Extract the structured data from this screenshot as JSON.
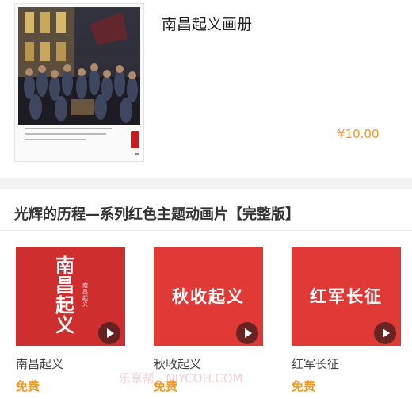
{
  "product": {
    "title": "南昌起义画册",
    "price": "¥10.00",
    "cover_icon": "painting-image"
  },
  "section": {
    "title": "光辉的历程—系列红色主题动画片【完整版】"
  },
  "videos": [
    {
      "thumb_lines": [
        "南",
        "昌",
        "起",
        "义"
      ],
      "thumb_subtitle": "南昌起义",
      "title": "南昌起义",
      "price": "免费",
      "icon": "play-icon"
    },
    {
      "thumb_text": "秋收起义",
      "title": "秋收起义",
      "price": "免费",
      "icon": "play-icon"
    },
    {
      "thumb_text": "红军长征",
      "title": "红军长征",
      "price": "免费",
      "icon": "play-icon"
    }
  ],
  "watermark": "乐享帮 · NJYCOH.COM",
  "colors": {
    "price": "#f19a25",
    "thumb_red": "#e13a36",
    "divider": "#f2f2f2"
  }
}
